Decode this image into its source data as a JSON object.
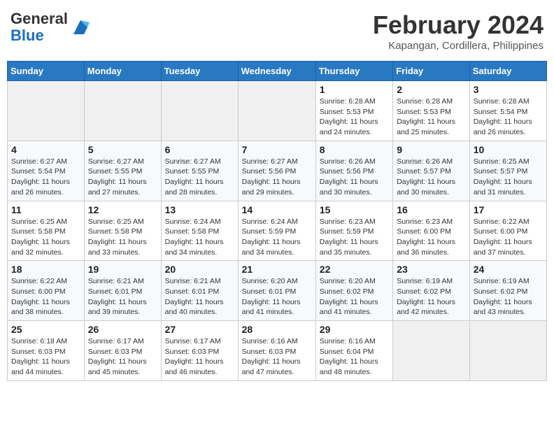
{
  "header": {
    "logo_general": "General",
    "logo_blue": "Blue",
    "month_title": "February 2024",
    "location": "Kapangan, Cordillera, Philippines"
  },
  "weekdays": [
    "Sunday",
    "Monday",
    "Tuesday",
    "Wednesday",
    "Thursday",
    "Friday",
    "Saturday"
  ],
  "weeks": [
    [
      {
        "day": "",
        "info": ""
      },
      {
        "day": "",
        "info": ""
      },
      {
        "day": "",
        "info": ""
      },
      {
        "day": "",
        "info": ""
      },
      {
        "day": "1",
        "info": "Sunrise: 6:28 AM\nSunset: 5:53 PM\nDaylight: 11 hours and 24 minutes."
      },
      {
        "day": "2",
        "info": "Sunrise: 6:28 AM\nSunset: 5:53 PM\nDaylight: 11 hours and 25 minutes."
      },
      {
        "day": "3",
        "info": "Sunrise: 6:28 AM\nSunset: 5:54 PM\nDaylight: 11 hours and 26 minutes."
      }
    ],
    [
      {
        "day": "4",
        "info": "Sunrise: 6:27 AM\nSunset: 5:54 PM\nDaylight: 11 hours and 26 minutes."
      },
      {
        "day": "5",
        "info": "Sunrise: 6:27 AM\nSunset: 5:55 PM\nDaylight: 11 hours and 27 minutes."
      },
      {
        "day": "6",
        "info": "Sunrise: 6:27 AM\nSunset: 5:55 PM\nDaylight: 11 hours and 28 minutes."
      },
      {
        "day": "7",
        "info": "Sunrise: 6:27 AM\nSunset: 5:56 PM\nDaylight: 11 hours and 29 minutes."
      },
      {
        "day": "8",
        "info": "Sunrise: 6:26 AM\nSunset: 5:56 PM\nDaylight: 11 hours and 30 minutes."
      },
      {
        "day": "9",
        "info": "Sunrise: 6:26 AM\nSunset: 5:57 PM\nDaylight: 11 hours and 30 minutes."
      },
      {
        "day": "10",
        "info": "Sunrise: 6:25 AM\nSunset: 5:57 PM\nDaylight: 11 hours and 31 minutes."
      }
    ],
    [
      {
        "day": "11",
        "info": "Sunrise: 6:25 AM\nSunset: 5:58 PM\nDaylight: 11 hours and 32 minutes."
      },
      {
        "day": "12",
        "info": "Sunrise: 6:25 AM\nSunset: 5:58 PM\nDaylight: 11 hours and 33 minutes."
      },
      {
        "day": "13",
        "info": "Sunrise: 6:24 AM\nSunset: 5:58 PM\nDaylight: 11 hours and 34 minutes."
      },
      {
        "day": "14",
        "info": "Sunrise: 6:24 AM\nSunset: 5:59 PM\nDaylight: 11 hours and 34 minutes."
      },
      {
        "day": "15",
        "info": "Sunrise: 6:23 AM\nSunset: 5:59 PM\nDaylight: 11 hours and 35 minutes."
      },
      {
        "day": "16",
        "info": "Sunrise: 6:23 AM\nSunset: 6:00 PM\nDaylight: 11 hours and 36 minutes."
      },
      {
        "day": "17",
        "info": "Sunrise: 6:22 AM\nSunset: 6:00 PM\nDaylight: 11 hours and 37 minutes."
      }
    ],
    [
      {
        "day": "18",
        "info": "Sunrise: 6:22 AM\nSunset: 6:00 PM\nDaylight: 11 hours and 38 minutes."
      },
      {
        "day": "19",
        "info": "Sunrise: 6:21 AM\nSunset: 6:01 PM\nDaylight: 11 hours and 39 minutes."
      },
      {
        "day": "20",
        "info": "Sunrise: 6:21 AM\nSunset: 6:01 PM\nDaylight: 11 hours and 40 minutes."
      },
      {
        "day": "21",
        "info": "Sunrise: 6:20 AM\nSunset: 6:01 PM\nDaylight: 11 hours and 41 minutes."
      },
      {
        "day": "22",
        "info": "Sunrise: 6:20 AM\nSunset: 6:02 PM\nDaylight: 11 hours and 41 minutes."
      },
      {
        "day": "23",
        "info": "Sunrise: 6:19 AM\nSunset: 6:02 PM\nDaylight: 11 hours and 42 minutes."
      },
      {
        "day": "24",
        "info": "Sunrise: 6:19 AM\nSunset: 6:02 PM\nDaylight: 11 hours and 43 minutes."
      }
    ],
    [
      {
        "day": "25",
        "info": "Sunrise: 6:18 AM\nSunset: 6:03 PM\nDaylight: 11 hours and 44 minutes."
      },
      {
        "day": "26",
        "info": "Sunrise: 6:17 AM\nSunset: 6:03 PM\nDaylight: 11 hours and 45 minutes."
      },
      {
        "day": "27",
        "info": "Sunrise: 6:17 AM\nSunset: 6:03 PM\nDaylight: 11 hours and 46 minutes."
      },
      {
        "day": "28",
        "info": "Sunrise: 6:16 AM\nSunset: 6:03 PM\nDaylight: 11 hours and 47 minutes."
      },
      {
        "day": "29",
        "info": "Sunrise: 6:16 AM\nSunset: 6:04 PM\nDaylight: 11 hours and 48 minutes."
      },
      {
        "day": "",
        "info": ""
      },
      {
        "day": "",
        "info": ""
      }
    ]
  ]
}
